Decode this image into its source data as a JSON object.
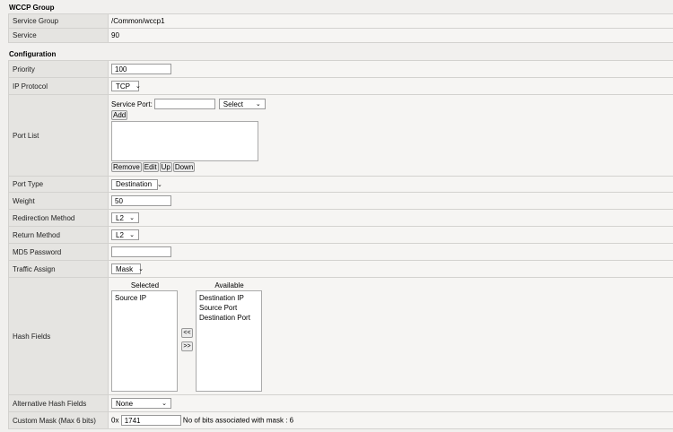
{
  "wccp": {
    "heading": "WCCP Group",
    "service_group_label": "Service Group",
    "service_group": "/Common/wccp1",
    "service_label": "Service",
    "service": "90"
  },
  "config": {
    "heading": "Configuration",
    "priority_label": "Priority",
    "priority": "100",
    "ip_protocol_label": "IP Protocol",
    "ip_protocol": "TCP",
    "port_list_label": "Port List",
    "service_port_label": "Service Port:",
    "service_port": "",
    "port_select": "Select",
    "add": "Add",
    "remove": "Remove",
    "edit": "Edit",
    "up": "Up",
    "down": "Down",
    "port_type_label": "Port Type",
    "port_type": "Destination",
    "weight_label": "Weight",
    "weight": "50",
    "redirection_label": "Redirection Method",
    "redirection": "L2",
    "return_label": "Return Method",
    "return": "L2",
    "md5_label": "MD5 Password",
    "md5": "",
    "traffic_label": "Traffic Assign",
    "traffic": "Mask",
    "hash_label": "Hash Fields",
    "selected_label": "Selected",
    "available_label": "Available",
    "selected": [
      "Source IP"
    ],
    "available": [
      "Destination IP",
      "Source Port",
      "Destination Port"
    ],
    "move_left": "<<",
    "move_right": ">>",
    "alt_hash_label": "Alternative Hash Fields",
    "alt_hash": "None",
    "mask_label": "Custom Mask (Max 6 bits)",
    "mask_prefix": "0x",
    "mask": "1741",
    "mask_note": "No of bits associated with mask : 6"
  }
}
